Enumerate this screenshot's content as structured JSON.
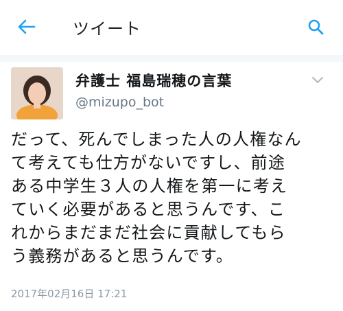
{
  "header": {
    "title": "ツイート",
    "back_icon": "arrow-left-icon",
    "search_icon": "search-icon",
    "accent": "#1da1f2"
  },
  "tweet": {
    "display_name": "弁護士 福島瑞穂の言葉",
    "handle": "@mizupo_bot",
    "text": "だって、死んでしまった人の人権なん\nて考えても仕方がないですし、前途\nある中学生３人の人権を第一に考え\nていく必要があると思うんです、こ\nれからまだまだ社会に貢献してもら\nう義務があると思うんです。",
    "timestamp": "2017年02月16日 17:21",
    "menu_icon": "chevron-down-icon"
  }
}
